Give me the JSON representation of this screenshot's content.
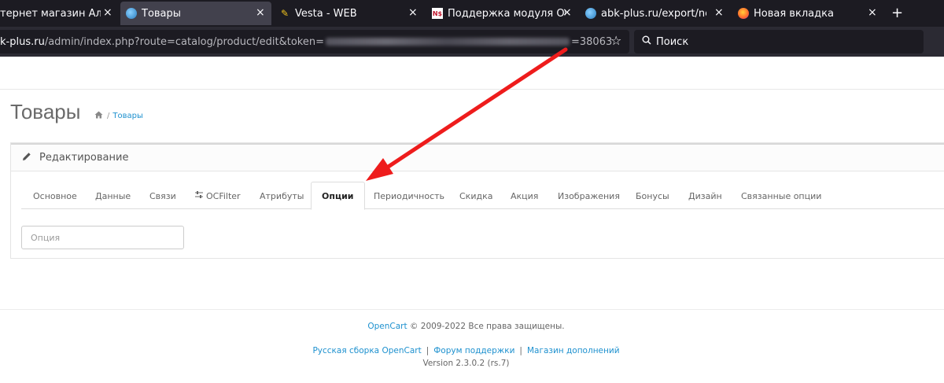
{
  "browser": {
    "tabs": [
      {
        "title": "тернет магазин Алта",
        "active": false,
        "icon": "globe-icon"
      },
      {
        "title": "Товары",
        "active": true,
        "icon": "globe-icon"
      },
      {
        "title": "Vesta - WEB",
        "active": false,
        "icon": "vesta-icon"
      },
      {
        "title": "Поддержка модуля Обн",
        "active": false,
        "icon": "ns-icon"
      },
      {
        "title": "abk-plus.ru/export/neose",
        "active": false,
        "icon": "globe-icon"
      },
      {
        "title": "Новая вкладка",
        "active": false,
        "icon": "firefox-icon"
      }
    ],
    "close_glyph": "×",
    "new_tab_glyph": "+",
    "url": {
      "host": "k-plus.ru",
      "path": "/admin/index.php?route=catalog/product/edit&token=",
      "tail": "=38063"
    },
    "search_placeholder": "Поиск",
    "ns_badge": "N$"
  },
  "page": {
    "title": "Товары",
    "breadcrumb": {
      "sep": "/",
      "current": "Товары"
    },
    "panel_title": "Редактирование",
    "tabs": [
      {
        "label": "Основное"
      },
      {
        "label": "Данные"
      },
      {
        "label": "Связи"
      },
      {
        "label": "OCFilter"
      },
      {
        "label": "Атрибуты"
      },
      {
        "label": "Опции",
        "active": true
      },
      {
        "label": "Периодичность"
      },
      {
        "label": "Скидка"
      },
      {
        "label": "Акция"
      },
      {
        "label": "Изображения"
      },
      {
        "label": "Бонусы"
      },
      {
        "label": "Дизайн"
      },
      {
        "label": "Связанные опции"
      }
    ],
    "option_input_placeholder": "Опция"
  },
  "footer": {
    "brand": "OpenCart",
    "copyright": "© 2009-2022 Все права защищены.",
    "links": [
      "Русская сборка OpenCart",
      "Форум поддержки",
      "Магазин дополнений"
    ],
    "link_separator": "|",
    "version": "Version 2.3.0.2 (rs.7)"
  },
  "annotation": {
    "color": "#ee1c1c"
  }
}
